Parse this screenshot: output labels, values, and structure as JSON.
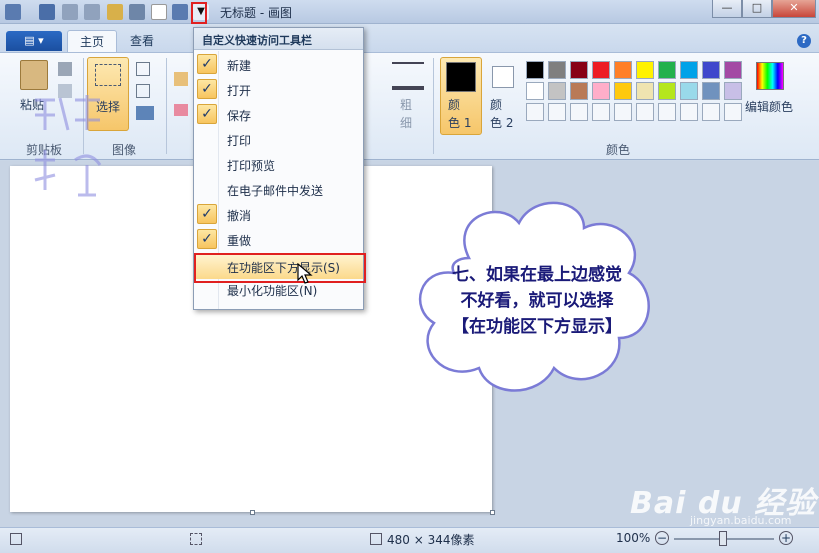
{
  "window": {
    "title": "无标题 - 画图",
    "min": "—",
    "max": "□",
    "close": "✕"
  },
  "tabs": {
    "menu": "▤ ▾",
    "home": "主页",
    "view": "查看",
    "help": "?"
  },
  "ribbon": {
    "paste": "粘贴",
    "clipboard_group": "剪贴板",
    "select": "选择",
    "image_group": "图像",
    "size": "粗\n细",
    "color1": "颜\n色 1",
    "color2": "颜\n色 2",
    "edit_colors": "编辑颜色",
    "colors_group": "颜色",
    "palette": [
      "#000000",
      "#7f7f7f",
      "#880015",
      "#ed1c24",
      "#ff7f27",
      "#fff200",
      "#22b14c",
      "#00a2e8",
      "#3f48cc",
      "#a349a4",
      "#ffffff",
      "#c3c3c3",
      "#b97a57",
      "#ffaec9",
      "#ffc90e",
      "#efe4b0",
      "#b5e61d",
      "#99d9ea",
      "#7092be",
      "#c8bfe7"
    ]
  },
  "menu": {
    "header": "自定义快速访问工具栏",
    "items": [
      {
        "label": "新建",
        "checked": true
      },
      {
        "label": "打开",
        "checked": true
      },
      {
        "label": "保存",
        "checked": true
      },
      {
        "label": "打印",
        "checked": false
      },
      {
        "label": "打印预览",
        "checked": false
      },
      {
        "label": "在电子邮件中发送",
        "checked": false
      },
      {
        "label": "撤消",
        "checked": true
      },
      {
        "label": "重做",
        "checked": true
      },
      {
        "label": "在功能区下方显示(S)",
        "checked": false
      },
      {
        "label": "最小化功能区(N)",
        "checked": false
      }
    ]
  },
  "callout": "七、如果在最上边感觉不好看，就可以选择【在功能区下方显示】",
  "status": {
    "dimensions": "480 × 344像素",
    "zoom": "100%",
    "minus": "−",
    "plus": "+"
  },
  "watermark": {
    "logo": "Bai du 经验",
    "url": "jingyan.baidu.com"
  }
}
